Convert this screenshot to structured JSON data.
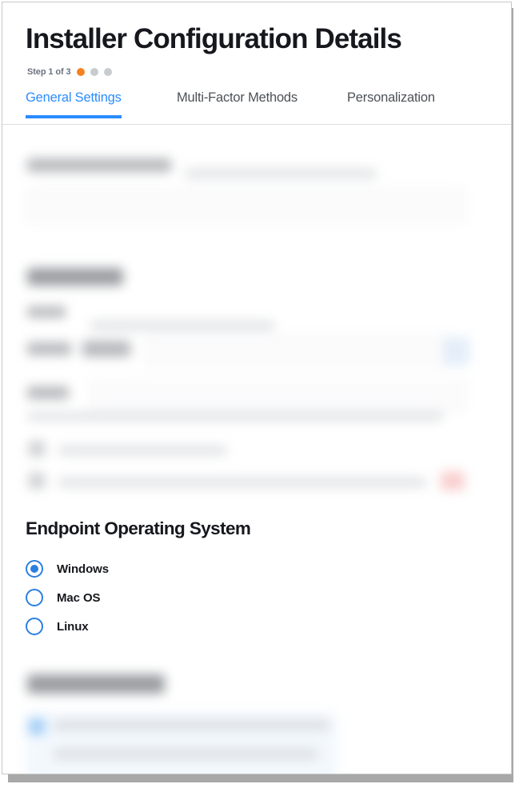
{
  "window": {
    "title": "Installer Configuration Details"
  },
  "header": {
    "title": "Installer Configuration Details",
    "step_label": "Step 1 of 3",
    "steps": [
      {
        "index": 1,
        "state": "active",
        "color": "#f58220"
      },
      {
        "index": 2,
        "state": "inactive",
        "color": "#c8cbd0"
      },
      {
        "index": 3,
        "state": "inactive",
        "color": "#c8cbd0"
      }
    ]
  },
  "tabs": {
    "active_index": 0,
    "active_color": "#2b8cff",
    "inactive_color": "#4c5157",
    "items": [
      {
        "label": "General Settings",
        "active": true
      },
      {
        "label": "Multi-Factor Methods",
        "active": false
      },
      {
        "label": "Personalization",
        "active": false
      }
    ]
  },
  "redacted_sections": {
    "note": "blurred",
    "count": 3
  },
  "os_section": {
    "title": "Endpoint Operating System",
    "selected": "Windows",
    "accent_color": "#2b7fe0",
    "options": [
      {
        "label": "Windows",
        "selected": true
      },
      {
        "label": "Mac OS",
        "selected": false
      },
      {
        "label": "Linux",
        "selected": false
      }
    ]
  }
}
